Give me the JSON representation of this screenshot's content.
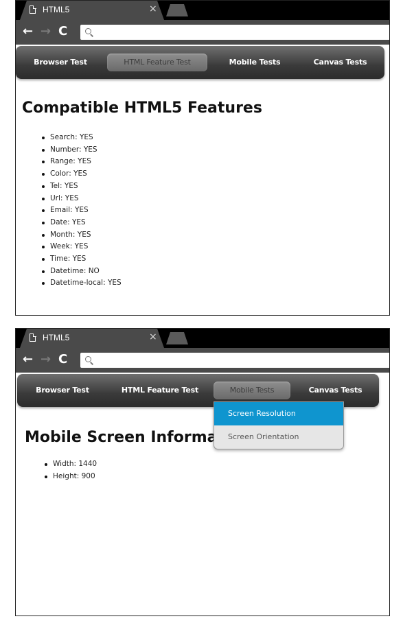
{
  "browser": {
    "tab_title": "HTML5",
    "close_glyph": "×",
    "back_glyph": "←",
    "forward_glyph": "→",
    "reload_glyph": "C"
  },
  "menu": {
    "browser_test": "Browser Test",
    "html_feature_test": "HTML Feature Test",
    "mobile_tests": "Mobile Tests",
    "canvas_tests": "Canvas Tests"
  },
  "view1": {
    "active_menu": "HTML Feature Test",
    "heading": "Compatible HTML5 Features",
    "features": [
      "Search: YES",
      "Number: YES",
      "Range: YES",
      "Color: YES",
      "Tel: YES",
      "Url: YES",
      "Email: YES",
      "Date: YES",
      "Month: YES",
      "Week: YES",
      "Time: YES",
      "Datetime: NO",
      "Datetime-local: YES"
    ]
  },
  "view2": {
    "active_menu": "Mobile Tests",
    "heading": "Mobile Screen Information",
    "dropdown": {
      "items": [
        "Screen Resolution",
        "Screen Orientation"
      ],
      "selected": "Screen Resolution"
    },
    "info": [
      "Width: 1440",
      "Height: 900"
    ]
  },
  "colors": {
    "dropdown_selected": "#0f95cf",
    "browser_chrome": "#4a4a4a"
  }
}
